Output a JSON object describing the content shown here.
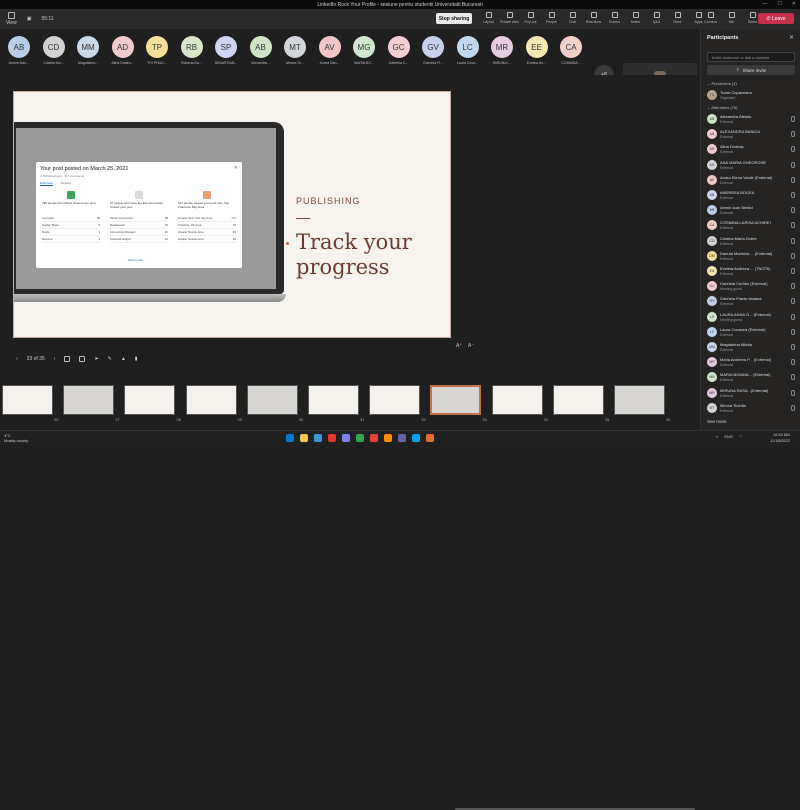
{
  "window": {
    "title": "LinkedIn Rock Your Profile - sesiune pentru studentii Universitatii Bucuresti"
  },
  "toolbar": {
    "view_label": "View",
    "timer": "55:11",
    "stop_sharing": "Stop sharing",
    "tools": [
      "Layout",
      "Private view",
      "Pop out",
      "People",
      "Chat",
      "Reactions",
      "Rooms",
      "Notes",
      "Q&A",
      "More",
      "Apps"
    ],
    "right_tools": [
      "Camera",
      "Mic",
      "Share"
    ],
    "leave_label": "Leave"
  },
  "gallery": {
    "participants": [
      {
        "initials": "AB",
        "name": "Amnin Ivan...",
        "color": "#b9cde8"
      },
      {
        "initials": "CD",
        "name": "Cristina Mo...",
        "color": "#d2d2d2"
      },
      {
        "initials": "MM",
        "name": "Magdalena...",
        "color": "#c7d9ea"
      },
      {
        "initials": "AD",
        "name": "Alina Dodea...",
        "color": "#f2c9cf"
      },
      {
        "initials": "TP",
        "name": "THI PHUO...",
        "color": "#f6df9a"
      },
      {
        "initials": "RB",
        "name": "Roberta Da...",
        "color": "#d9e7c9"
      },
      {
        "initials": "SP",
        "name": "SEBASTIAN...",
        "color": "#cfd5f2"
      },
      {
        "initials": "AB",
        "name": "Alexandra...",
        "color": "#cfe4c7"
      },
      {
        "initials": "MT",
        "name": "Mircea Tir...",
        "color": "#d2d6da"
      },
      {
        "initials": "AV",
        "name": "Andra Dan...",
        "color": "#f3c6c6"
      },
      {
        "initials": "MG",
        "name": "MARIA BO...",
        "color": "#cfe8cf"
      },
      {
        "initials": "GC",
        "name": "Gabriela C...",
        "color": "#f4cdd3"
      },
      {
        "initials": "GV",
        "name": "Gabriela Fl...",
        "color": "#c6d0ea"
      },
      {
        "initials": "LC",
        "name": "Laura Cova...",
        "color": "#bfd8ef"
      },
      {
        "initials": "MR",
        "name": "MIRUNA I...",
        "color": "#e7cbe0"
      },
      {
        "initials": "EE",
        "name": "Evelina An...",
        "color": "#f6e7b3"
      },
      {
        "initials": "CA",
        "name": "COSMINA...",
        "color": "#f2d0c8"
      }
    ],
    "more_count": "+8"
  },
  "slide": {
    "section": "PUBLISHING",
    "heading_line1": "Track your",
    "heading_line2": "progress",
    "post_title": "Your post posted on March 25, 2021",
    "post_sub": "4,780 Reactions · 317 comments",
    "tabs": [
      "Edit/Insta",
      "Viewers"
    ],
    "columns": [
      {
        "head": "720 people from Plano viewed your post",
        "icon_color": "#3fa35b",
        "rows": [
          [
            "Lancaster",
            "28"
          ],
          [
            "Golden Plaza",
            "5"
          ],
          [
            "Bustle",
            "4"
          ],
          [
            "Resume",
            "3"
          ]
        ]
      },
      {
        "head": "57 people who have the title Accountant viewed your post",
        "icon_color": "#d8d8d8",
        "rows": [
          [
            "Senior Accountant",
            "38"
          ],
          [
            "Bookkeeper",
            "16"
          ],
          [
            "Accounting Manager",
            "16"
          ],
          [
            "Financial analyst",
            "12"
          ]
        ]
      },
      {
        "head": "617 people viewed your post from San Francisco Bay Area",
        "icon_color": "#e6a07a",
        "rows": [
          [
            "Greater New York City Area",
            "171"
          ],
          [
            "Charlotte, US Area",
            "23"
          ],
          [
            "Greater Boston Area",
            "19"
          ],
          [
            "Greater Seattle Area",
            "18"
          ]
        ]
      }
    ],
    "more_link": "Show more"
  },
  "controls": {
    "page_indicator": "33 of 35"
  },
  "filmstrip": {
    "numbers": [
      "26",
      "27",
      "28",
      "29",
      "30",
      "31",
      "32",
      "33",
      "34",
      "35",
      "36"
    ]
  },
  "panel": {
    "title": "Participants",
    "invite_placeholder": "Invite someone or dial a number",
    "share_invite": "Share invite",
    "presenters_label": "Presenters (1)",
    "attendees_label": "Attendees (75)",
    "see_more": "See more",
    "presenter": {
      "name": "Tudor Copaceanu",
      "role": "Organizer",
      "initials": "TC",
      "color": "#b7a48d"
    },
    "attendees": [
      {
        "initials": "AB",
        "name": "Alexandra Bletoiu",
        "role": "External",
        "color": "#cfe4c7"
      },
      {
        "initials": "AB",
        "name": "ALEXANDRA BANICA",
        "role": "External",
        "color": "#f4cdd3"
      },
      {
        "initials": "AD",
        "name": "Alina Dodeac",
        "role": "External",
        "color": "#f2c9cf"
      },
      {
        "initials": "AG",
        "name": "ANA MARIA GHEORGHE",
        "role": "External",
        "color": "#d2d6da"
      },
      {
        "initials": "AV",
        "name": "Andra Elena Vasile (External)",
        "role": "External",
        "color": "#f3c6c6"
      },
      {
        "initials": "AB",
        "name": "ANDREEA BOGEA",
        "role": "External",
        "color": "#cfd5f2"
      },
      {
        "initials": "AB",
        "name": "Amnin Ioan Beldici",
        "role": "External",
        "color": "#b9cde8"
      },
      {
        "initials": "CA",
        "name": "COSMINA LARISA ACHIREI",
        "role": "External",
        "color": "#f2d0c8"
      },
      {
        "initials": "CD",
        "name": "Cristina Maria Dobre",
        "role": "External",
        "color": "#d2d2d2"
      },
      {
        "initials": "DM",
        "name": "Danuta Marinela ... (External)",
        "role": "External",
        "color": "#f6df9a"
      },
      {
        "initials": "EA",
        "name": "Evelina Andreea ... (TN/276)",
        "role": "External",
        "color": "#f6e7b3"
      },
      {
        "initials": "GC",
        "name": "Gabriela Curtian (External)",
        "role": "Meeting guest",
        "color": "#f4cdd3"
      },
      {
        "initials": "GV",
        "name": "Gabriela Flavia Vadana",
        "role": "External",
        "color": "#c6d0ea"
      },
      {
        "initials": "LG",
        "name": "LAURA ANNA G... (External)",
        "role": "Meeting guest",
        "color": "#cfe8cf"
      },
      {
        "initials": "LC",
        "name": "Laura Covacea (External)",
        "role": "External",
        "color": "#bfd8ef"
      },
      {
        "initials": "MM",
        "name": "Magdalena Mitrita",
        "role": "External",
        "color": "#c7d9ea"
      },
      {
        "initials": "MP",
        "name": "Maria Andreea P... (External)",
        "role": "External",
        "color": "#e7cbe0"
      },
      {
        "initials": "MB",
        "name": "MARIA BOIANA... (External)",
        "role": "External",
        "color": "#cfe8cf"
      },
      {
        "initials": "MR",
        "name": "MIRUNA RASA...(External)",
        "role": "External",
        "color": "#e7cbe0"
      },
      {
        "initials": "MT",
        "name": "Mircea Tirchila",
        "role": "External",
        "color": "#d2d6da"
      }
    ]
  },
  "taskbar": {
    "temp": "4°C",
    "weather": "Mostly cloudy",
    "lang": "ENG",
    "time": "10:42 AM",
    "date": "11/18/2022",
    "app_colors": [
      "#0078d4",
      "#f2c94c",
      "#3a96dd",
      "#e3342f",
      "#7b83eb",
      "#34a853",
      "#ea4335",
      "#ff8c00",
      "#6264a7",
      "#00a4ef",
      "#e66b2e"
    ]
  }
}
